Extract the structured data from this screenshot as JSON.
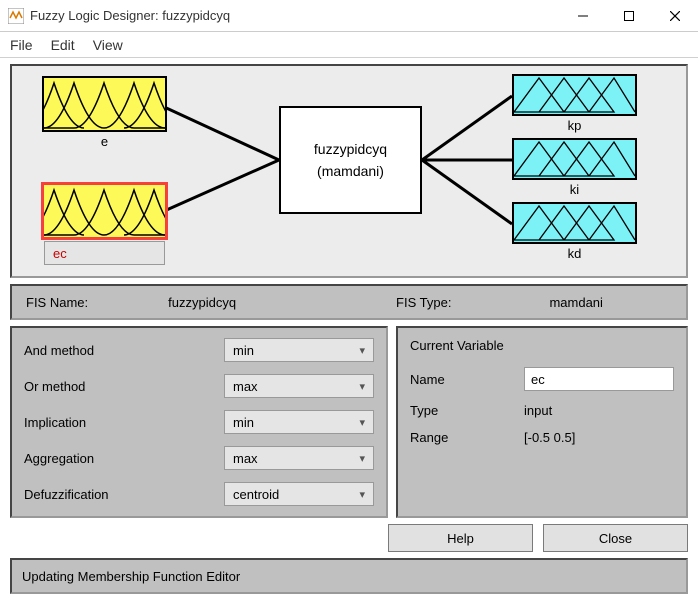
{
  "window": {
    "title": "Fuzzy Logic Designer: fuzzypidcyq"
  },
  "menu": {
    "file": "File",
    "edit": "Edit",
    "view": "View"
  },
  "diagram": {
    "inputs": [
      {
        "name": "e",
        "selected": false
      },
      {
        "name": "ec",
        "selected": true
      }
    ],
    "outputs": [
      {
        "name": "kp"
      },
      {
        "name": "ki"
      },
      {
        "name": "kd"
      }
    ],
    "rule": {
      "name": "fuzzypidcyq",
      "type": "(mamdani)"
    }
  },
  "fis": {
    "name_label": "FIS Name:",
    "name": "fuzzypidcyq",
    "type_label": "FIS Type:",
    "type": "mamdani"
  },
  "methods": {
    "and": {
      "label": "And method",
      "value": "min"
    },
    "or": {
      "label": "Or method",
      "value": "max"
    },
    "imp": {
      "label": "Implication",
      "value": "min"
    },
    "agg": {
      "label": "Aggregation",
      "value": "max"
    },
    "defuzz": {
      "label": "Defuzzification",
      "value": "centroid"
    }
  },
  "current": {
    "heading": "Current Variable",
    "name_label": "Name",
    "name": "ec",
    "type_label": "Type",
    "type": "input",
    "range_label": "Range",
    "range": "[-0.5 0.5]"
  },
  "buttons": {
    "help": "Help",
    "close": "Close"
  },
  "status": "Updating Membership Function Editor"
}
